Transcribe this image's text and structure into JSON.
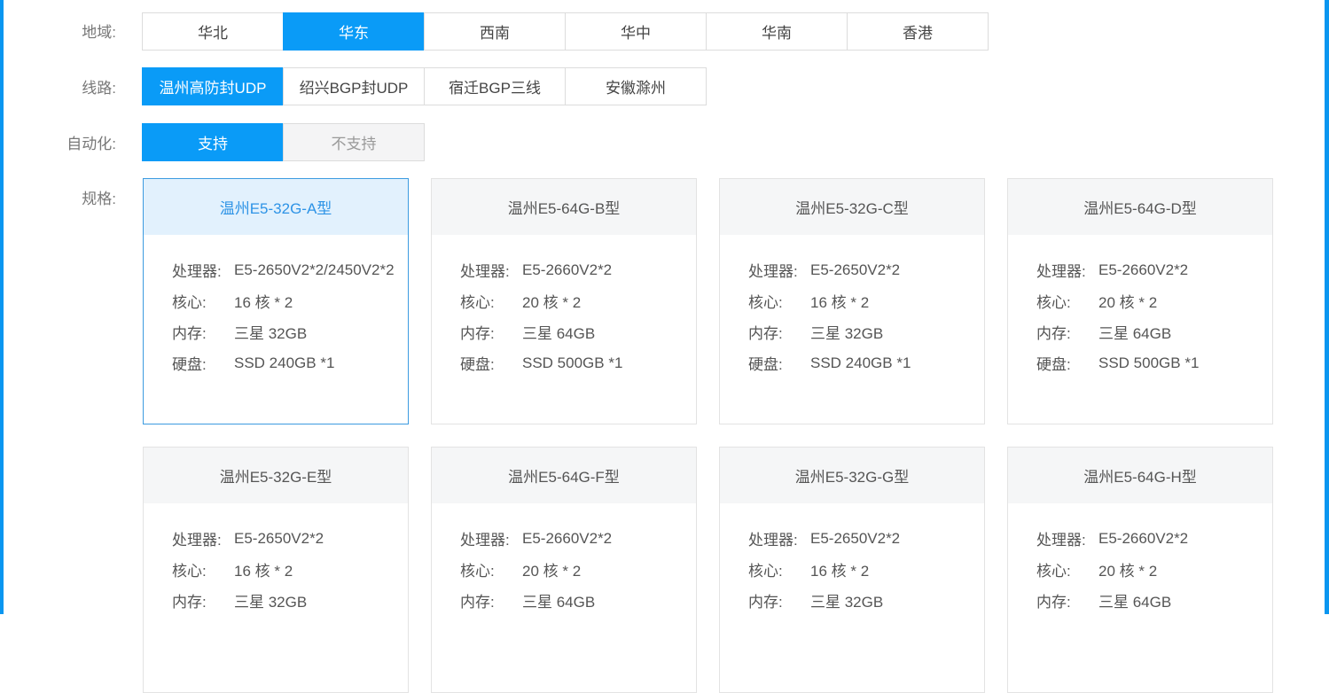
{
  "region": {
    "label": "地域:",
    "options": [
      "华北",
      "华东",
      "西南",
      "华中",
      "华南",
      "香港"
    ],
    "selected": "华东"
  },
  "line": {
    "label": "线路:",
    "options": [
      "温州高防封UDP",
      "绍兴BGP封UDP",
      "宿迁BGP三线",
      "安徽滁州"
    ],
    "selected": "温州高防封UDP"
  },
  "automation": {
    "label": "自动化:",
    "options": [
      "支持",
      "不支持"
    ],
    "selected": "支持"
  },
  "spec": {
    "label": "规格:",
    "keys": {
      "cpu": "处理器:",
      "cores": "核心:",
      "memory": "内存:",
      "disk": "硬盘:"
    },
    "cards": [
      {
        "title": "温州E5-32G-A型",
        "cpu": "E5-2650V2*2/2450V2*2",
        "cores": "16 核 * 2",
        "memory": "三星 32GB",
        "disk": "SSD 240GB *1",
        "selected": true
      },
      {
        "title": "温州E5-64G-B型",
        "cpu": "E5-2660V2*2",
        "cores": "20 核 * 2",
        "memory": "三星 64GB",
        "disk": "SSD 500GB *1",
        "selected": false
      },
      {
        "title": "温州E5-32G-C型",
        "cpu": "E5-2650V2*2",
        "cores": "16 核 * 2",
        "memory": "三星 32GB",
        "disk": "SSD 240GB *1",
        "selected": false
      },
      {
        "title": "温州E5-64G-D型",
        "cpu": "E5-2660V2*2",
        "cores": "20 核 * 2",
        "memory": "三星 64GB",
        "disk": "SSD 500GB *1",
        "selected": false
      },
      {
        "title": "温州E5-32G-E型",
        "cpu": "E5-2650V2*2",
        "cores": "16 核 * 2",
        "memory": "三星 32GB",
        "selected": false
      },
      {
        "title": "温州E5-64G-F型",
        "cpu": "E5-2660V2*2",
        "cores": "20 核 * 2",
        "memory": "三星 64GB",
        "selected": false
      },
      {
        "title": "温州E5-32G-G型",
        "cpu": "E5-2650V2*2",
        "cores": "16 核 * 2",
        "memory": "三星 32GB",
        "selected": false
      },
      {
        "title": "温州E5-64G-H型",
        "cpu": "E5-2660V2*2",
        "cores": "20 核 * 2",
        "memory": "三星 64GB",
        "selected": false
      }
    ]
  },
  "colors": {
    "accent": "#0a9bf7",
    "selected_card_border": "#3c9be0",
    "selected_card_header": "#e2f1fd"
  }
}
